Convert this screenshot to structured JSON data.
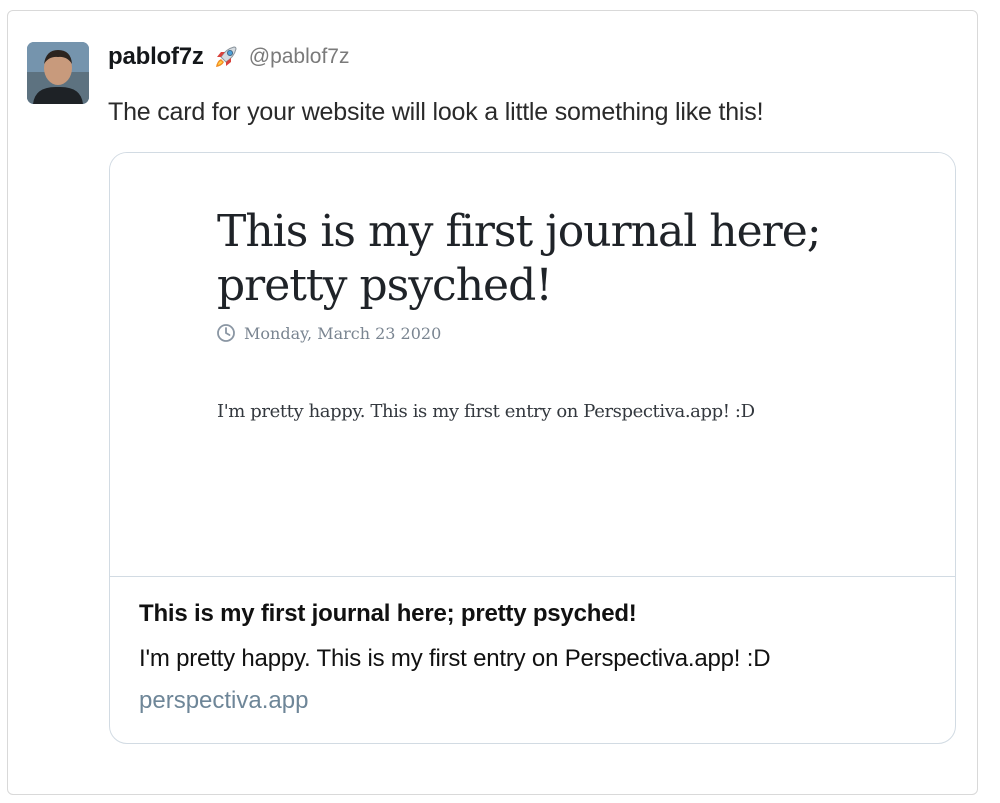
{
  "tweet": {
    "display_name": "pablof7z",
    "handle": "@pablof7z",
    "text": "The card for your website will look a little something like this!",
    "avatar_icon": "profile-photo",
    "name_emoji_icon": "rocket-icon"
  },
  "card": {
    "image": {
      "journal_title": "This is my first journal here; pretty psyched!",
      "date_icon": "clock-icon",
      "date": "Monday, March 23 2020",
      "body": "I'm pretty happy. This is my first entry on Perspectiva.app! :D"
    },
    "title": "This is my first journal here; pretty psyched!",
    "description": "I'm pretty happy. This is my first entry on Perspectiva.app! :D",
    "domain": "perspectiva.app"
  },
  "colors": {
    "border": "#d9d9d9",
    "card_border": "#d2dbe3",
    "handle_gray": "#7a7a7a",
    "domain_blue_gray": "#6e8698",
    "clock_gray": "#8a96a3"
  }
}
